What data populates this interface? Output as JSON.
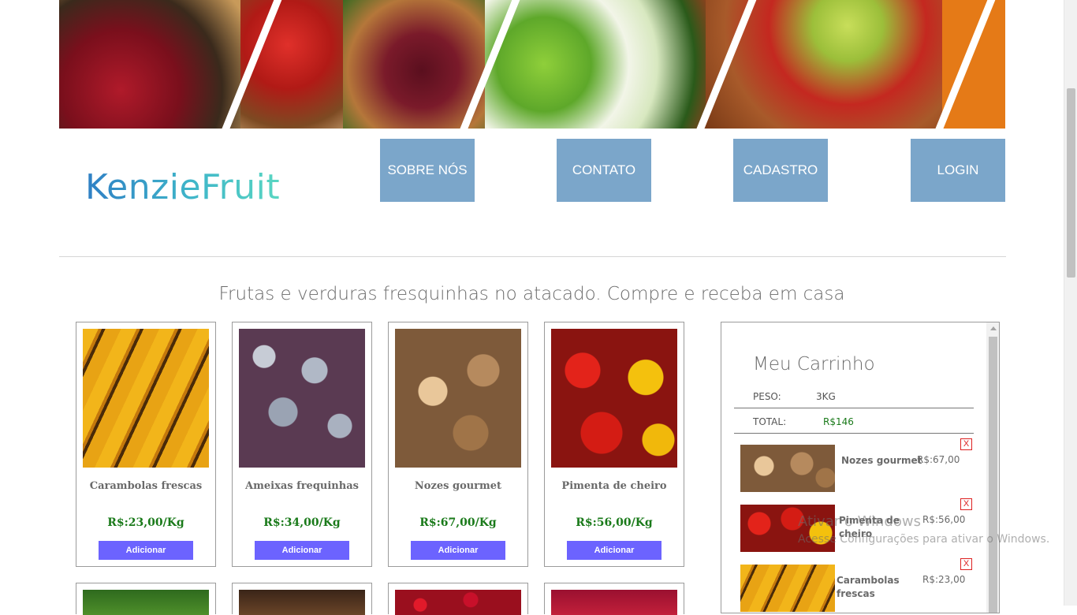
{
  "header": {
    "logo_text": "KenzieFruit",
    "nav": [
      "SOBRE NÓS",
      "CONTATO",
      "CADASTRO",
      "LOGIN"
    ]
  },
  "tagline": "Frutas e verduras fresquinhas no atacado. Compre e receba em casa",
  "products": [
    {
      "name": "Carambolas frescas",
      "price": "R$:23,00/Kg",
      "button": "Adicionar"
    },
    {
      "name": "Ameixas frequinhas",
      "price": "R$:34,00/Kg",
      "button": "Adicionar"
    },
    {
      "name": "Nozes gourmet",
      "price": "R$:67,00/Kg",
      "button": "Adicionar"
    },
    {
      "name": "Pimenta de cheiro",
      "price": "R$:56,00/Kg",
      "button": "Adicionar"
    }
  ],
  "cart": {
    "title": "Meu Carrinho",
    "weight_label": "PESO:",
    "weight_value": "3KG",
    "total_label": "TOTAL:",
    "total_value": "R$146",
    "remove_label": "X",
    "items": [
      {
        "name": "Nozes gourmet",
        "price": "R$:67,00"
      },
      {
        "name": "Pimenta de cheiro",
        "price": "R$:56,00"
      },
      {
        "name": "Carambolas frescas",
        "price": "R$:23,00"
      }
    ]
  },
  "watermark": {
    "line1": "Ativar o Windows",
    "line2": "Acesse Configurações para ativar o Windows."
  },
  "colors": {
    "nav_button": "#7ba6ca",
    "add_button": "#6c63ff",
    "price_green": "#1a7a1a",
    "remove_red": "#dd2222"
  }
}
